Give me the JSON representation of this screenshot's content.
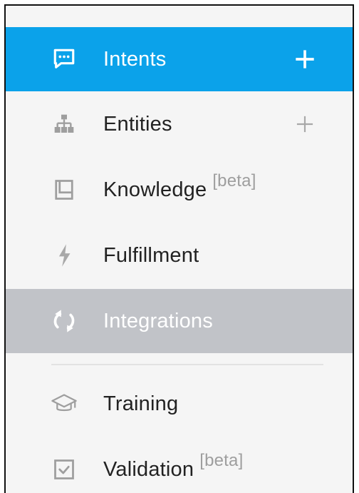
{
  "menu": {
    "items": [
      {
        "label": "Intents",
        "icon": "chat-bubble-icon",
        "has_add": true,
        "state": "active"
      },
      {
        "label": "Entities",
        "icon": "hierarchy-icon",
        "has_add": true
      },
      {
        "label": "Knowledge",
        "suffix": "[beta]",
        "icon": "book-icon"
      },
      {
        "label": "Fulfillment",
        "icon": "lightning-icon"
      },
      {
        "label": "Integrations",
        "icon": "sync-icon",
        "state": "hover"
      },
      {
        "label": "Training",
        "icon": "graduation-cap-icon"
      },
      {
        "label": "Validation",
        "suffix": "[beta]",
        "icon": "checkbox-icon"
      }
    ]
  },
  "colors": {
    "active_bg": "#0ba2ea",
    "hover_bg": "#c1c3c8",
    "icon_grey": "#9e9e9e",
    "text": "#222222",
    "sidebar_bg": "#f5f5f5"
  }
}
